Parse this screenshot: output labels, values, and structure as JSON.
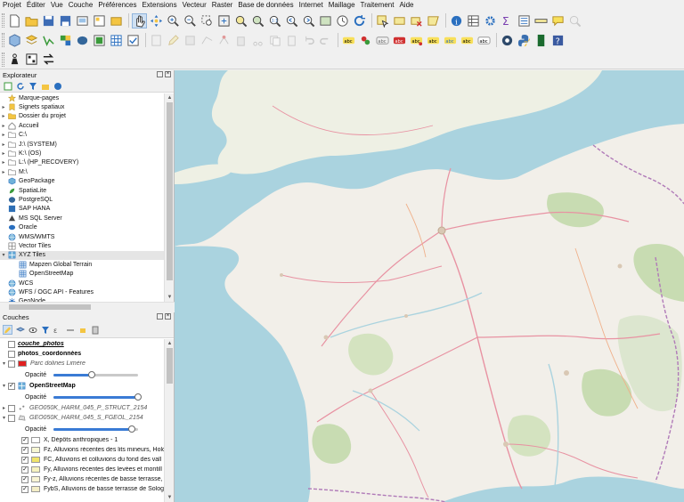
{
  "menu": [
    "Projet",
    "Éditer",
    "Vue",
    "Couche",
    "Préférences",
    "Extensions",
    "Vecteur",
    "Raster",
    "Base de données",
    "Internet",
    "Maillage",
    "Traitement",
    "Aide"
  ],
  "browser": {
    "title": "Explorateur",
    "items": [
      {
        "label": "Marque-pages",
        "icon": "star-icon",
        "arrow": ""
      },
      {
        "label": "Signets spatiaux",
        "icon": "bookmark-icon",
        "arrow": "▸"
      },
      {
        "label": "Dossier du projet",
        "icon": "folder-icon",
        "arrow": "▸"
      },
      {
        "label": "Accueil",
        "icon": "home-icon",
        "arrow": "▸"
      },
      {
        "label": "C:\\",
        "icon": "drive-icon",
        "arrow": "▸"
      },
      {
        "label": "J:\\ (SYSTEM)",
        "icon": "drive-icon",
        "arrow": "▸"
      },
      {
        "label": "K:\\ (OS)",
        "icon": "drive-icon",
        "arrow": "▸"
      },
      {
        "label": "L:\\ (HP_RECOVERY)",
        "icon": "drive-icon",
        "arrow": "▸"
      },
      {
        "label": "M:\\",
        "icon": "drive-icon",
        "arrow": "▸"
      },
      {
        "label": "GeoPackage",
        "icon": "geopackage-icon",
        "arrow": ""
      },
      {
        "label": "SpatiaLite",
        "icon": "spatialite-icon",
        "arrow": ""
      },
      {
        "label": "PostgreSQL",
        "icon": "postgresql-icon",
        "arrow": ""
      },
      {
        "label": "SAP HANA",
        "icon": "database-icon",
        "arrow": ""
      },
      {
        "label": "MS SQL Server",
        "icon": "mssql-icon",
        "arrow": ""
      },
      {
        "label": "Oracle",
        "icon": "oracle-icon",
        "arrow": ""
      },
      {
        "label": "WMS/WMTS",
        "icon": "globe-icon",
        "arrow": ""
      },
      {
        "label": "Vector Tiles",
        "icon": "vector-tiles-icon",
        "arrow": ""
      },
      {
        "label": "XYZ Tiles",
        "icon": "xyz-tiles-icon",
        "arrow": "▾",
        "selected": true
      },
      {
        "label": "Mapzen Global Terrain",
        "icon": "grid-icon",
        "arrow": "",
        "indent": true
      },
      {
        "label": "OpenStreetMap",
        "icon": "grid-icon",
        "arrow": "",
        "indent": true
      },
      {
        "label": "WCS",
        "icon": "globe-icon",
        "arrow": ""
      },
      {
        "label": "WFS / OGC API - Features",
        "icon": "globe-icon",
        "arrow": ""
      },
      {
        "label": "GeoNode",
        "icon": "geonode-icon",
        "arrow": ""
      }
    ]
  },
  "layers": {
    "title": "Couches",
    "opacity_label": "Opacité",
    "rows": [
      {
        "kind": "layer",
        "label": "couche_photos",
        "style": "italic-underline",
        "checked": false,
        "swatch": "",
        "arrow": ""
      },
      {
        "kind": "layer",
        "label": "photos_coordonnées",
        "style": "bold",
        "checked": false,
        "swatch": "",
        "arrow": ""
      },
      {
        "kind": "layer",
        "label": "Parc dolines Limère",
        "style": "italic",
        "checked": false,
        "swatch": "#e02020",
        "arrow": "▾"
      },
      {
        "kind": "opacity",
        "value": 0.45
      },
      {
        "kind": "layer",
        "label": "OpenStreetMap",
        "style": "bold",
        "checked": true,
        "swatch": "",
        "icon": "xyz-tiles-icon",
        "arrow": "▾"
      },
      {
        "kind": "opacity",
        "value": 1.0
      },
      {
        "kind": "layer",
        "label": "GEO050K_HARM_045_P_STRUCT_2154",
        "style": "italic",
        "checked": false,
        "swatch": "",
        "icon": "point-layer-icon",
        "arrow": "▸"
      },
      {
        "kind": "layer",
        "label": "GEO050K_HARM_045_S_FGEOL_2154",
        "style": "italic",
        "checked": false,
        "swatch": "",
        "icon": "polygon-layer-icon",
        "arrow": "▾"
      },
      {
        "kind": "opacity",
        "value": 0.92
      },
      {
        "kind": "class",
        "label": "X, Dépôts anthropiques - 1",
        "checked": true,
        "swatch": "#ffffff"
      },
      {
        "kind": "class",
        "label": "Fz, Alluvions récentes des lits mineurs, Holo",
        "checked": true,
        "swatch": "#f6f6d2"
      },
      {
        "kind": "class",
        "label": "FC, Alluvions et colluvions du fond des vall",
        "checked": true,
        "swatch": "#f0e46a"
      },
      {
        "kind": "class",
        "label": "Fy, Alluvions récentes des levées et montill",
        "checked": true,
        "swatch": "#f6f2c0"
      },
      {
        "kind": "class",
        "label": "Fy-z, Alluvions récentes de basse terrasse,",
        "checked": true,
        "swatch": "#f8f4d4"
      },
      {
        "kind": "class",
        "label": "FybS, Alluvions de basse terrasse de Sologn",
        "checked": true,
        "swatch": "#f4eec6"
      }
    ]
  },
  "colors": {
    "sea": "#aad3df",
    "land": "#f2efe9",
    "forest": "#c8dcb2",
    "border": "#b07ab8",
    "road": "#e892a2",
    "accent": "#3a7bd5"
  }
}
